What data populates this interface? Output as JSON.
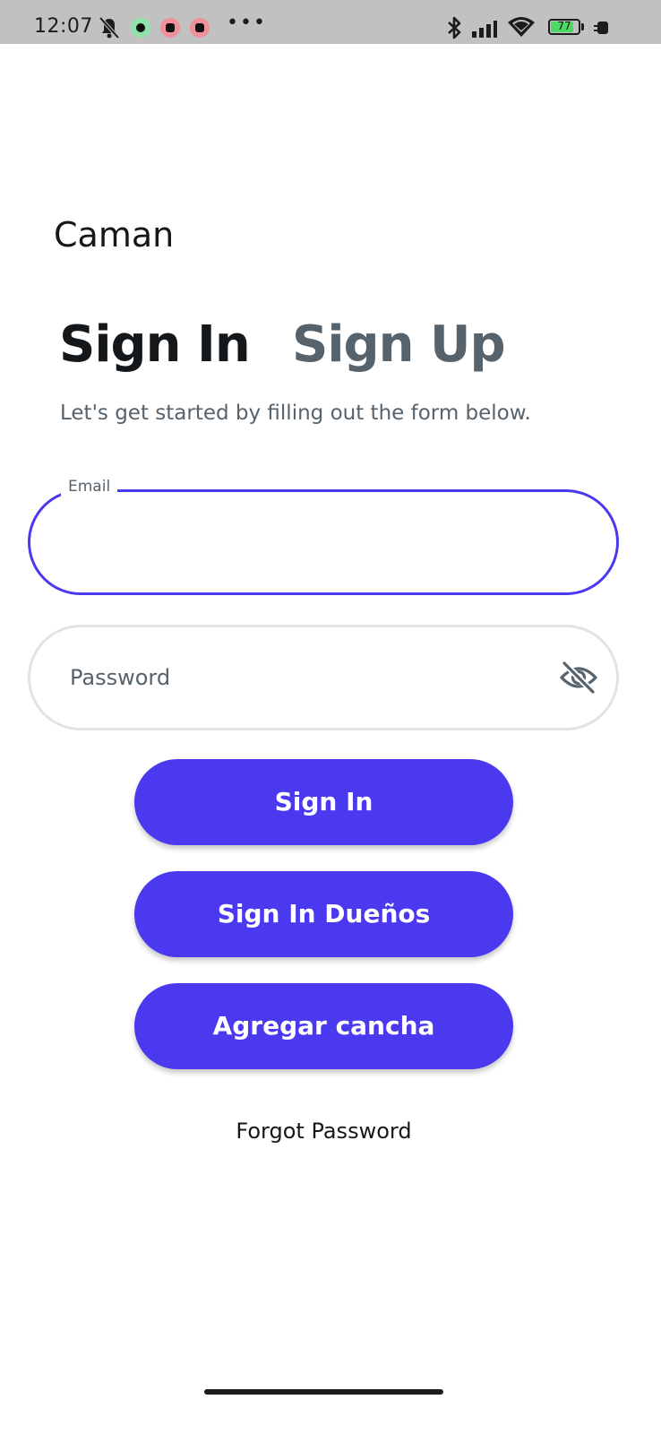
{
  "status_bar": {
    "time": "12:07",
    "battery_level": "77",
    "battery_fraction": 0.77,
    "icons": [
      "notifications-off-icon",
      "whatsapp-icon",
      "gmail-icon",
      "youtube-icon",
      "more-icon",
      "bluetooth-icon",
      "signal-icon",
      "wifi-icon",
      "battery-icon",
      "charging-icon"
    ],
    "more": "•••"
  },
  "app": {
    "title": "Caman"
  },
  "tabs": {
    "sign_in": "Sign In",
    "sign_up": "Sign Up",
    "active": "sign_in"
  },
  "subtitle": "Let's get started by filling out the form below.",
  "form": {
    "email": {
      "label": "Email",
      "value": ""
    },
    "password": {
      "placeholder": "Password",
      "value": ""
    }
  },
  "buttons": {
    "sign_in": "Sign In",
    "sign_in_owners": "Sign In Dueños",
    "add_court": "Agregar cancha",
    "forgot_password": "Forgot Password"
  },
  "colors": {
    "primary": "#4b39ef",
    "primary_text": "#14181b",
    "secondary_text": "#57636c",
    "border": "#e0e3e7",
    "status_bar": "#c1c1c1"
  }
}
